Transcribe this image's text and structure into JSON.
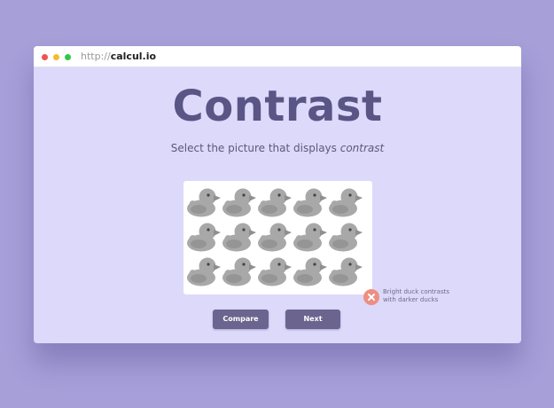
{
  "browser": {
    "url_protocol": "http://",
    "url_host": "calcul.io"
  },
  "page": {
    "title": "Contrast",
    "instruction_prefix": "Select the picture that displays ",
    "instruction_emphasis": "contrast"
  },
  "picture": {
    "rows": 3,
    "columns": 5,
    "duck_color": "#a8a8a8",
    "duck_shade": "#959595",
    "beak_color": "#8f8f8f",
    "eye_color": "#444444"
  },
  "feedback": {
    "icon": "error-x-icon",
    "color": "#ee8e83",
    "line1": "Bright duck contrasts",
    "line2": "with darker ducks"
  },
  "buttons": {
    "compare_label": "Compare",
    "next_label": "Next"
  }
}
